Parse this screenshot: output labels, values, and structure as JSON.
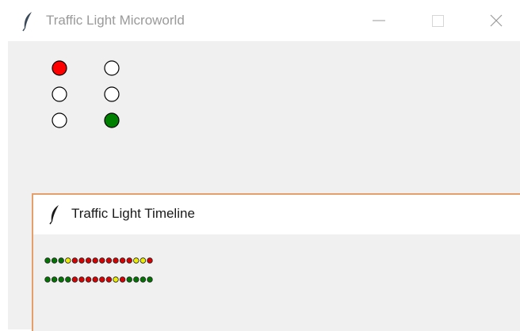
{
  "main_window": {
    "title": "Traffic Light Microworld",
    "icon": "feather-icon",
    "controls": [
      "minimize-icon",
      "maximize-icon",
      "close-icon"
    ],
    "lights": {
      "left": [
        "red",
        "off",
        "off"
      ],
      "right": [
        "off",
        "off",
        "green"
      ]
    }
  },
  "timeline_window": {
    "title": "Traffic Light Timeline",
    "icon": "feather-icon",
    "rows": [
      [
        "green",
        "green",
        "green",
        "yellow",
        "red",
        "red",
        "red",
        "red",
        "red",
        "red",
        "red",
        "red",
        "red",
        "yellow",
        "yellow",
        "red"
      ],
      [
        "green",
        "green",
        "green",
        "green",
        "red",
        "red",
        "red",
        "red",
        "red",
        "red",
        "yellow",
        "red",
        "green",
        "green",
        "green",
        "green"
      ]
    ]
  },
  "colors": {
    "red": "#ff0000",
    "green": "#008000",
    "yellow": "#ffff00",
    "off": "#ffffff",
    "timeline_red": "#dd0000",
    "timeline_green": "#007700",
    "timeline_yellow": "#eeee00",
    "background": "#f0f0f0",
    "focus_border": "#e3a06c"
  }
}
